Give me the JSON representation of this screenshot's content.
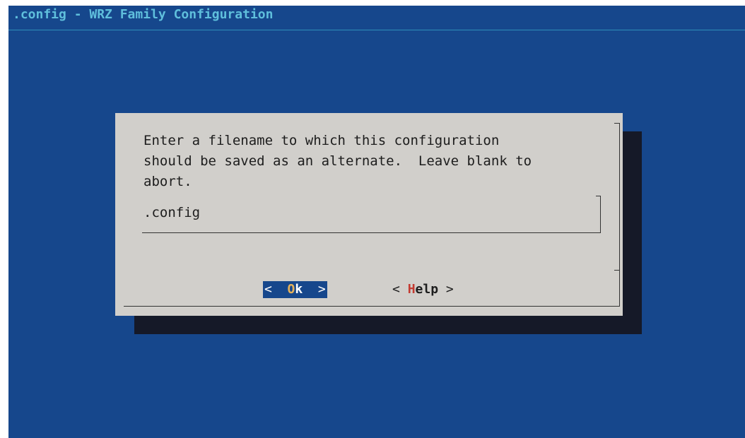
{
  "window": {
    "title": ".config - WRZ Family Configuration"
  },
  "dialog": {
    "prompt": "Enter a filename to which this configuration\nshould be saved as an alternate.  Leave blank to\nabort.",
    "filename_value": ".config",
    "buttons": {
      "ok": {
        "left": "<",
        "hotkey": "O",
        "rest": "k",
        "right": ">"
      },
      "help": {
        "left": "<",
        "hotkey": "H",
        "rest": "elp",
        "right": ">"
      }
    }
  },
  "colors": {
    "background": "#16478c",
    "dialog": "#d1cfcb",
    "shadow": "#151928",
    "title": "#5fbfdc",
    "hotkey_ok": "#e6b25a",
    "hotkey_help": "#c43a30"
  }
}
